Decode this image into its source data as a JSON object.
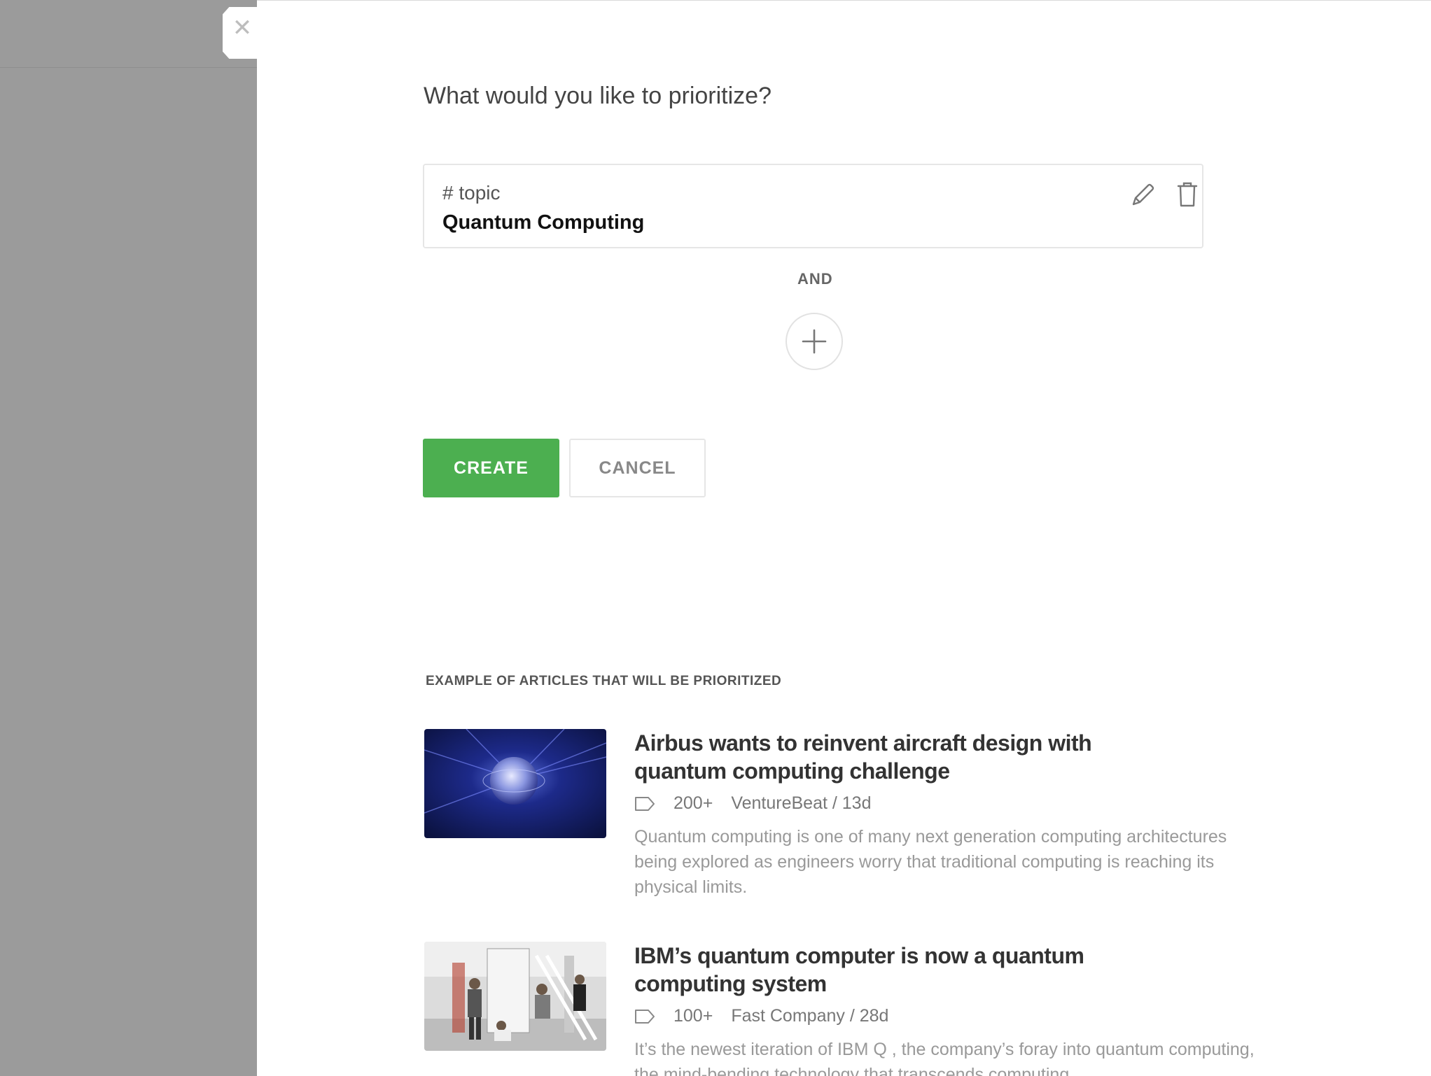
{
  "modal": {
    "close_glyph": "✕",
    "question": "What would you like to prioritize?"
  },
  "topic": {
    "kind": "# topic",
    "name": "Quantum Computing"
  },
  "connector": "AND",
  "buttons": {
    "create": "CREATE",
    "cancel": "CANCEL"
  },
  "examples": {
    "heading": "EXAMPLE OF ARTICLES THAT WILL BE PRIORITIZED",
    "articles": [
      {
        "title": "Airbus wants to reinvent aircraft design with quantum computing challenge",
        "count": "200+",
        "source": "VentureBeat / 13d",
        "summary": "Quantum computing is one of many next generation computing architectures being explored as engineers worry that traditional computing is reaching its physical limits."
      },
      {
        "title": "IBM’s quantum computer is now a quantum computing system",
        "count": "100+",
        "source": "Fast Company / 28d",
        "summary": "It’s the newest iteration of IBM Q , the company’s foray into quantum computing, the mind-bending technology that transcends computing"
      }
    ]
  },
  "colors": {
    "accent_green": "#4caf50",
    "backdrop_gray": "#9b9b9b"
  },
  "icons": [
    "close-icon",
    "pencil-icon",
    "trash-icon",
    "plus-icon",
    "tag-icon"
  ]
}
